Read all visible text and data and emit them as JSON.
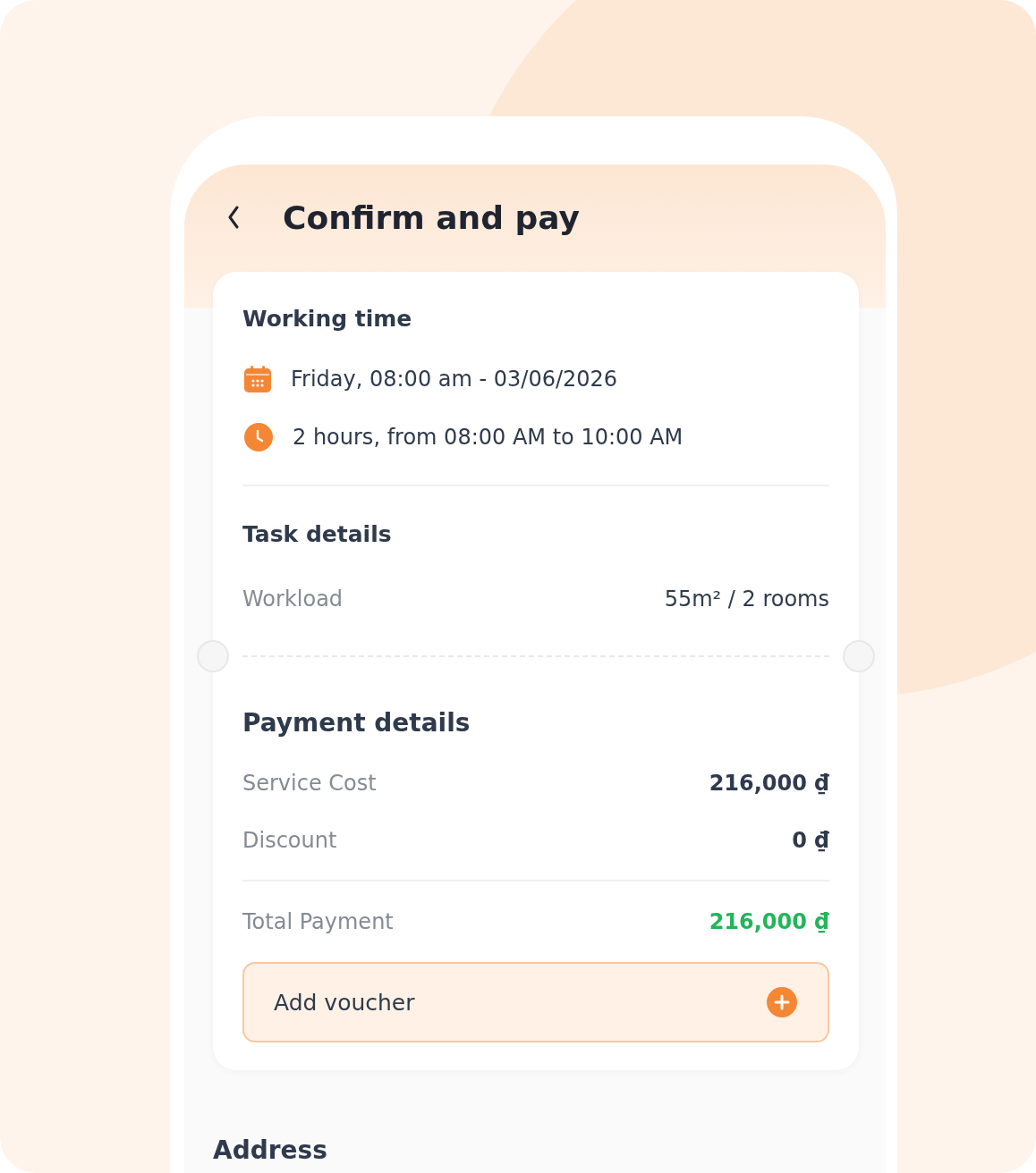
{
  "header": {
    "title": "Confirm and pay"
  },
  "working_time": {
    "title": "Working time",
    "items": [
      {
        "kind": "date",
        "text": "Friday, 08:00 am - 03/06/2026"
      },
      {
        "kind": "time",
        "text": "2 hours, from 08:00 AM to 10:00 AM"
      }
    ]
  },
  "task_details": {
    "title": "Task details",
    "rows": [
      {
        "label": "Workload",
        "value": "55m² / 2 rooms"
      }
    ]
  },
  "payment_details": {
    "title": "Payment details",
    "rows": [
      {
        "kind": "cost",
        "label": "Service Cost",
        "value": "216,000 ₫"
      },
      {
        "kind": "cost",
        "label": "Discount",
        "value": "0 ₫"
      },
      {
        "kind": "total",
        "label": "Total Payment",
        "value": "216,000 ₫"
      }
    ],
    "voucher": {
      "label": "Add voucher"
    }
  },
  "address": {
    "title": "Address"
  }
}
